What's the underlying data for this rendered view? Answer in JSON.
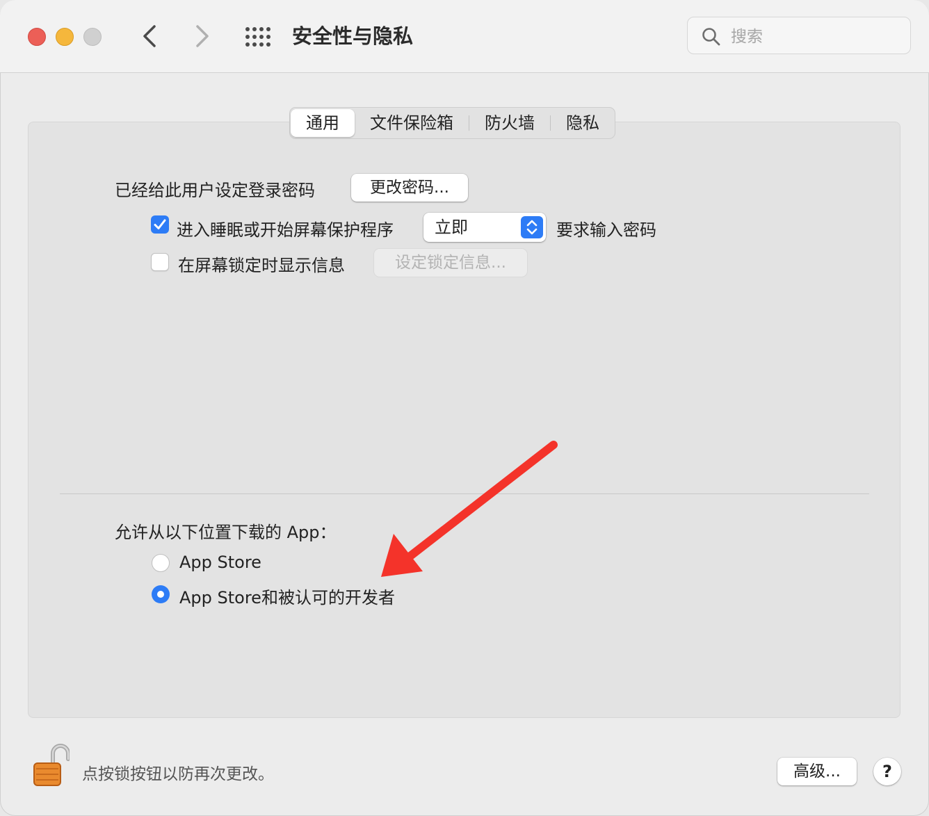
{
  "window": {
    "title": "安全性与隐私",
    "search_placeholder": "搜索"
  },
  "tabs": [
    {
      "label": "通用",
      "active": true
    },
    {
      "label": "文件保险箱",
      "active": false
    },
    {
      "label": "防火墙",
      "active": false
    },
    {
      "label": "隐私",
      "active": false
    }
  ],
  "general": {
    "password_set_label": "已经给此用户设定登录密码",
    "change_password_button": "更改密码...",
    "require_password": {
      "checked": true,
      "label_before": "进入睡眠或开始屏幕保护程序",
      "selected_value": "立即",
      "label_after": "要求输入密码"
    },
    "show_message": {
      "checked": false,
      "label": "在屏幕锁定时显示信息",
      "set_message_button": "设定锁定信息..."
    }
  },
  "download_section": {
    "heading": "允许从以下位置下载的 App：",
    "options": [
      {
        "label": "App Store",
        "selected": false
      },
      {
        "label": "App Store和被认可的开发者",
        "selected": true
      }
    ]
  },
  "footer": {
    "lock_text": "点按锁按钮以防再次更改。",
    "advanced_button": "高级...",
    "help_button": "?"
  },
  "colors": {
    "accent": "#2d7cf6",
    "annotation_arrow": "#f4332a"
  },
  "icons": {
    "back": "chevron-left-icon",
    "forward": "chevron-right-icon",
    "grid": "grid-icon",
    "search": "search-icon",
    "lock": "open-lock-icon"
  }
}
